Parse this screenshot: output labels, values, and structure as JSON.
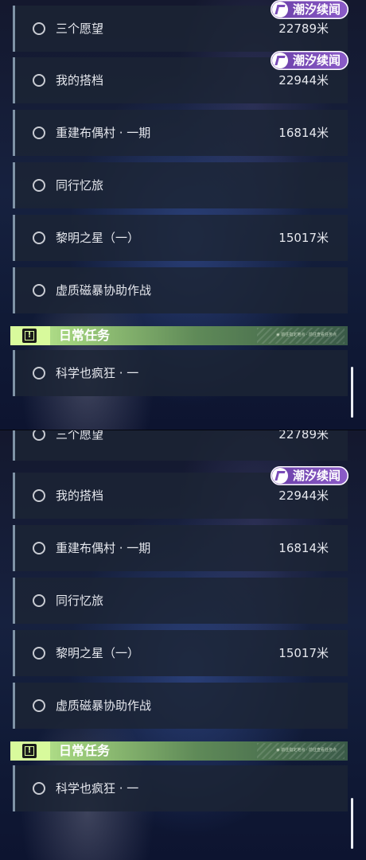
{
  "quests": [
    {
      "label": "三个愿望",
      "distance": "22789米"
    },
    {
      "label": "我的搭档",
      "distance": "22944米"
    },
    {
      "label": "重建布偶村 · 一期",
      "distance": "16814米"
    },
    {
      "label": "同行忆旅",
      "distance": ""
    },
    {
      "label": "黎明之星（一）",
      "distance": "15017米"
    },
    {
      "label": "虚质磁暴协助作战",
      "distance": ""
    }
  ],
  "daily_section": {
    "icon": "exclamation-icon",
    "badge_glyph": "!",
    "title": "日常任务",
    "fine_print": "◉ 前往指定地点 · 前往查看任务点"
  },
  "daily_quests": [
    {
      "label": "科学也疯狂 · 一",
      "distance": ""
    }
  ],
  "watermark": {
    "text": "潮汐续闻",
    "brand_color": "#7a4bb8"
  },
  "colors": {
    "row_accent": "#7f93a6",
    "section_accent": "#d8fa9c"
  }
}
